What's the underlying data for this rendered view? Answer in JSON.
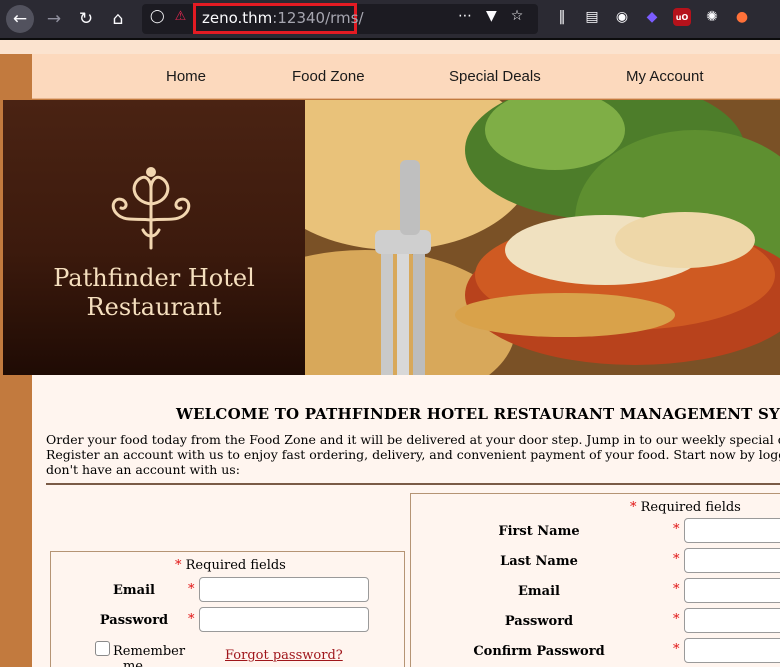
{
  "browser": {
    "url_host": "zeno.thm",
    "url_path": ":12340/rms/",
    "icons": {
      "back": "back-arrow-icon",
      "forward": "forward-arrow-icon",
      "reload": "reload-icon",
      "home": "home-icon"
    }
  },
  "nav": {
    "items": [
      "Home",
      "Food Zone",
      "Special Deals",
      "My Account"
    ]
  },
  "banner": {
    "hotel_line1": "Pathfinder Hotel",
    "hotel_line2": "Restaurant"
  },
  "content": {
    "welcome": "WELCOME TO PATHFINDER HOTEL RESTAURANT MANAGEMENT SYS",
    "intro_line1": "Order your food today from the Food Zone and it will be delivered at your door step. Jump in to our weekly special deal",
    "intro_line2": "Register an account with us to enjoy fast ordering, delivery, and convenient payment of your food. Start now by logging",
    "intro_line3": "don't have an account with us:"
  },
  "login": {
    "required_note": "Required fields",
    "email_label": "Email",
    "password_label": "Password",
    "remember_line1": "Remember",
    "remember_line2": "me",
    "forgot_link": "Forgot password?"
  },
  "register": {
    "required_note": "Required fields",
    "fields": [
      "First Name",
      "Last Name",
      "Email",
      "Password",
      "Confirm Password"
    ]
  },
  "colors": {
    "nav_bg": "#fcd9bd",
    "page_orange": "#c27a3e",
    "content_bg": "#fff5ef",
    "required_star": "#e01010",
    "link": "#a0161b"
  }
}
